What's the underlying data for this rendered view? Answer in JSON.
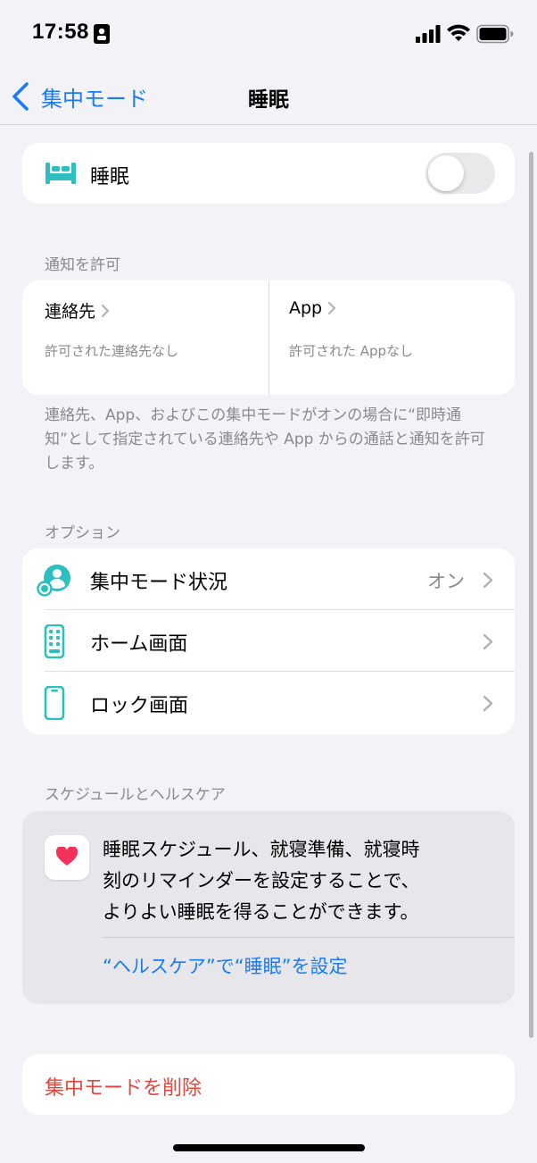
{
  "status_bar": {
    "time": "17:58"
  },
  "nav": {
    "back_label": "集中モード",
    "title": "睡眠"
  },
  "sleep_toggle": {
    "label": "睡眠",
    "on": false
  },
  "allow_notifications": {
    "header": "通知を許可",
    "contacts": {
      "title": "連絡先",
      "subtitle": "許可された連絡先なし"
    },
    "apps": {
      "title": "App",
      "subtitle": "許可された Appなし"
    },
    "footer": "連絡先、App、およびこの集中モードがオンの場合に“即時通知”として指定されている連絡先や App からの通話と通知を許可します。"
  },
  "options": {
    "header": "オプション",
    "items": [
      {
        "label": "集中モード状況",
        "value": "オン",
        "icon": "focus-status-icon"
      },
      {
        "label": "ホーム画面",
        "value": "",
        "icon": "home-screen-icon"
      },
      {
        "label": "ロック画面",
        "value": "",
        "icon": "lock-screen-icon"
      }
    ]
  },
  "schedule": {
    "header": "スケジュールとヘルスケア",
    "text_line1": "睡眠スケジュール、就寝準備、就寝時",
    "text_line2": "刻のリマインダーを設定することで、",
    "text_line3": "よりよい睡眠を得ることができます。",
    "link": "“ヘルスケア”で“睡眠”を設定"
  },
  "delete": {
    "label": "集中モードを削除"
  },
  "colors": {
    "accent": "#1a7cf5",
    "teal": "#2bbfbf",
    "destructive": "#e0483e",
    "heart": "#f5325c"
  }
}
